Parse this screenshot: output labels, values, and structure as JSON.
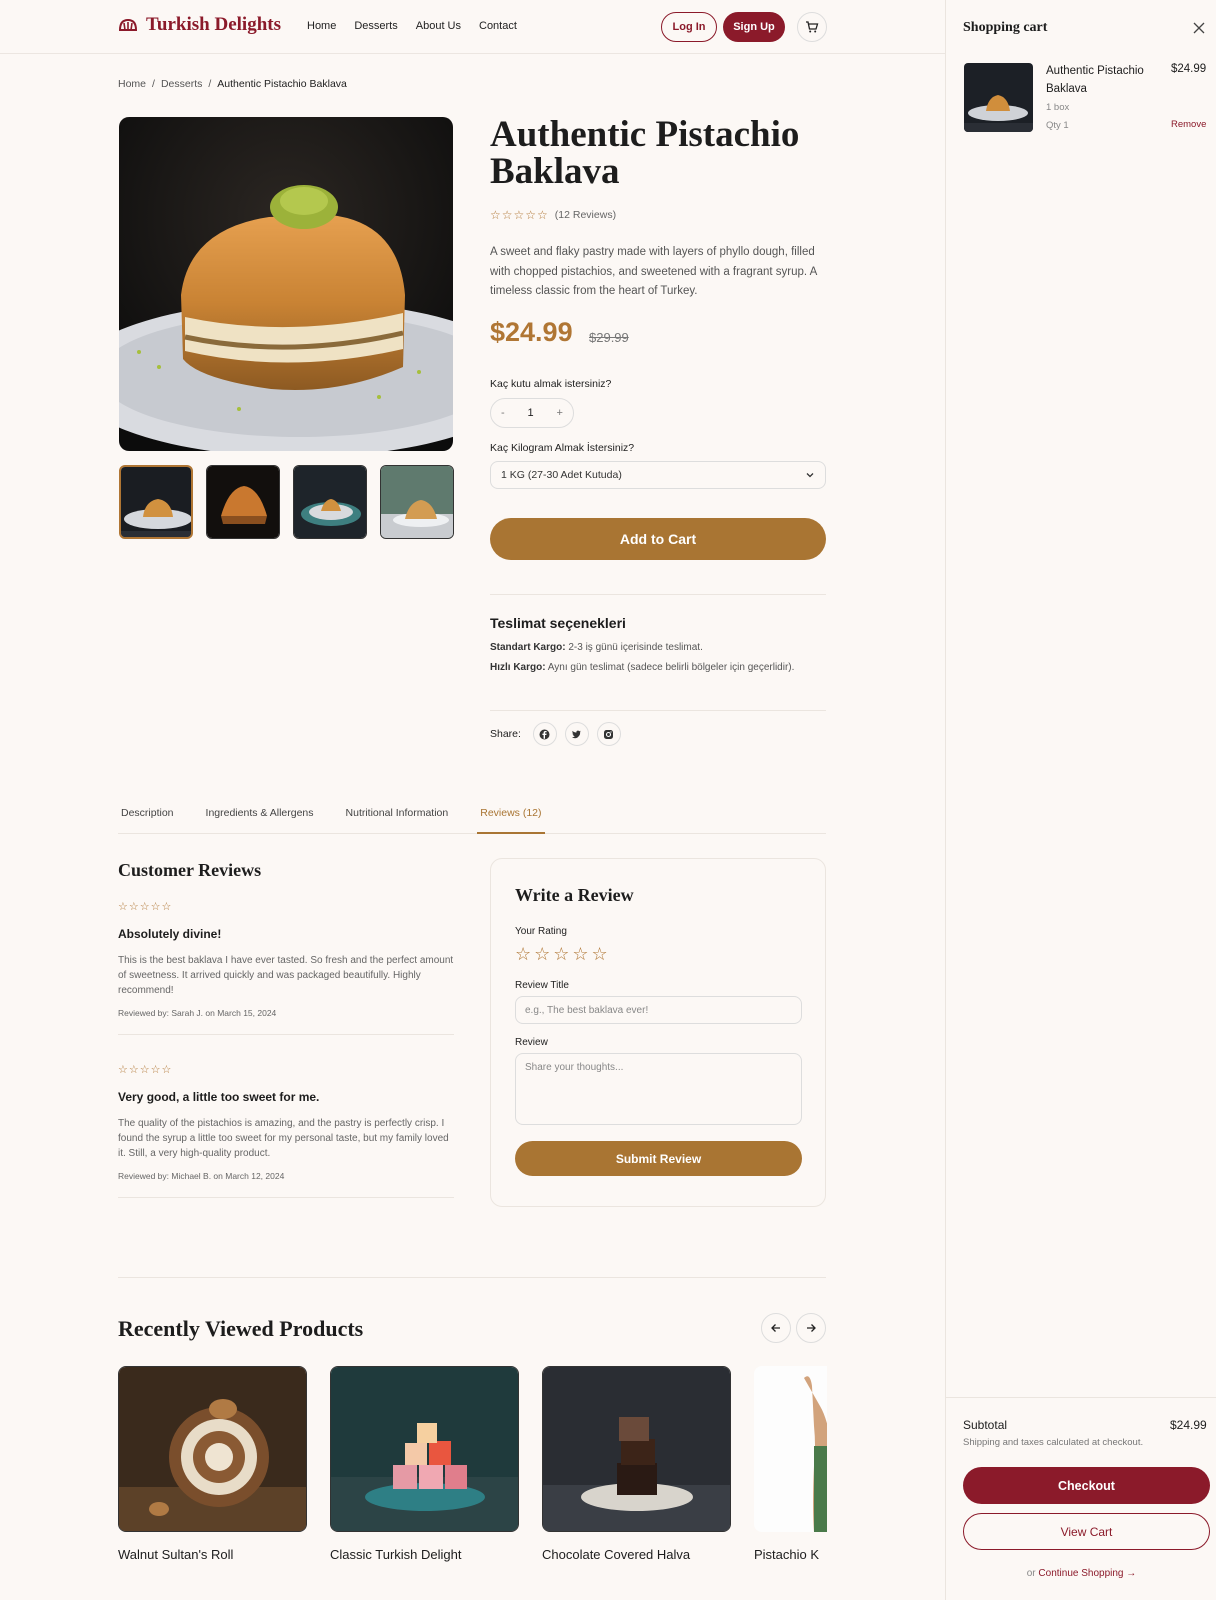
{
  "brand": {
    "name": "Turkish Delights",
    "accent": "#8b1a2a",
    "gold": "#a97533"
  },
  "nav": {
    "items": [
      "Home",
      "Desserts",
      "About Us",
      "Contact"
    ],
    "login": "Log In",
    "signup": "Sign Up"
  },
  "breadcrumb": {
    "home": "Home",
    "sep": "/",
    "category": "Desserts",
    "current": "Authentic Pistachio Baklava"
  },
  "product": {
    "title": "Authentic Pistachio Baklava",
    "rating_stars": "☆☆☆☆☆",
    "reviews_count": "(12 Reviews)",
    "description": "A sweet and flaky pastry made with layers of phyllo dough, filled with chopped pistachios, and sweetened with a fragrant syrup. A timeless classic from the heart of Turkey.",
    "price": "$24.99",
    "old_price": "$29.99",
    "qty_label": "Kaç kutu almak istersiniz?",
    "qty_minus": "-",
    "qty_value": "1",
    "qty_plus": "+",
    "weight_label": "Kaç Kilogram Almak İstersiniz?",
    "weight_value": "1 KG (27-30 Adet Kutuda)",
    "add_to_cart": "Add to Cart"
  },
  "shipping": {
    "title": "Teslimat seçenekleri",
    "standard_label": "Standart Kargo:",
    "standard_text": "2-3 iş günü içerisinde teslimat.",
    "express_label": "Hızlı Kargo:",
    "express_text": "Aynı gün teslimat (sadece belirli bölgeler için geçerlidir)."
  },
  "share": {
    "label": "Share:"
  },
  "tabs": [
    "Description",
    "Ingredients & Allergens",
    "Nutritional Information",
    "Reviews (12)"
  ],
  "reviews": {
    "title": "Customer Reviews",
    "items": [
      {
        "stars": "☆☆☆☆☆",
        "title": "Absolutely divine!",
        "body": "This is the best baklava I have ever tasted. So fresh and the perfect amount of sweetness. It arrived quickly and was packaged beautifully. Highly recommend!",
        "by": "Reviewed by: Sarah J. on March 15, 2024"
      },
      {
        "stars": "☆☆☆☆☆",
        "title": "Very good, a little too sweet for me.",
        "body": "The quality of the pistachios is amazing, and the pastry is perfectly crisp. I found the syrup a little too sweet for my personal taste, but my family loved it. Still, a very high-quality product.",
        "by": "Reviewed by: Michael B. on March 12, 2024"
      }
    ]
  },
  "write_review": {
    "title": "Write a Review",
    "rating_label": "Your Rating",
    "rating_stars": "☆☆☆☆☆",
    "title_label": "Review Title",
    "title_placeholder": "e.g., The best baklava ever!",
    "review_label": "Review",
    "review_placeholder": "Share your thoughts...",
    "submit": "Submit Review"
  },
  "recently_viewed": {
    "title": "Recently Viewed Products",
    "items": [
      {
        "name": "Walnut Sultan's Roll"
      },
      {
        "name": "Classic Turkish Delight"
      },
      {
        "name": "Chocolate Covered Halva"
      },
      {
        "name": "Pistachio K"
      }
    ]
  },
  "cart": {
    "title": "Shopping cart",
    "item": {
      "name": "Authentic Pistachio Baklava",
      "price": "$24.99",
      "variant": "1 box",
      "qty": "Qty 1",
      "remove": "Remove"
    },
    "subtotal_label": "Subtotal",
    "subtotal_value": "$24.99",
    "ship_note": "Shipping and taxes calculated at checkout.",
    "checkout": "Checkout",
    "view_cart": "View Cart",
    "continue_prefix": "or",
    "continue_link": "Continue Shopping →"
  }
}
